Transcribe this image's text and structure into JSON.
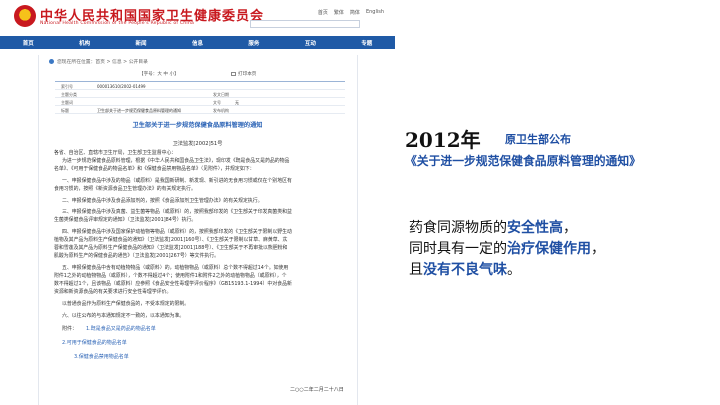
{
  "site": {
    "title": "中华人民共和国国家卫生健康委员会",
    "subtitle": "National Health Commission of the People's Republic of China",
    "top_links": [
      "首页",
      "繁体",
      "简体",
      "English"
    ]
  },
  "nav": [
    "首页",
    "机构",
    "新闻",
    "信息",
    "服务",
    "互动",
    "专题"
  ],
  "breadcrumb": "您现在所在位置：首页 > 信息 > 公开目录",
  "toolbar": {
    "font_size": "【字号：大 中 小】",
    "print": "打印本页"
  },
  "meta": {
    "rows": [
      {
        "k1": "索引号",
        "v1": "000013610/2002-01499",
        "k2": "",
        "v2": ""
      },
      {
        "k1": "主题分类",
        "v1": "",
        "k2": "发文日期",
        "v2": ""
      },
      {
        "k1": "主题词",
        "v1": "",
        "k2": "文号",
        "v2": "无"
      },
      {
        "k1": "标题",
        "v1": "卫生部关于进一步规范保健食品原料管理的通知",
        "k2": "发布机构",
        "v2": ""
      }
    ]
  },
  "document": {
    "title": "卫生部关于进一步规范保健食品原料管理的通知",
    "number": "卫法监发[2002]51号",
    "paragraphs": [
      "各省、自治区、直辖市卫生厅局，卫生部卫生监督中心：",
      "为进一步规范保健食品原料管理，根据《中华人民共和国食品卫生法》，现印发《既是食品又是药品的物品",
      "名单》、《可用于保健食品的物品名单》和《保健食品禁用物品名单》（见附件），并规定如下：",
      "一、申报保健食品中涉及的物品（或原料）是我国新研制、新发现、新引进的无食用习惯或仅在个别地区有",
      "食用习惯的，按照《新资源食品卫生管理办法》的有关规定执行。",
      "二、申报保健食品中涉及食品添加剂的，按照《食品添加剂卫生管理办法》的有关规定执行。",
      "三、申报保健食品中涉及真菌、益生菌等物品（或原料）的，按照我部印发的《卫生部关于印发真菌类和益",
      "生菌类保健食品评审规定的通知》（卫法监发[2001]84号）执行。",
      "四、申报保健食品中涉及国家保护动植物等物品（或原料）的，按照我部印发的《卫生部关于限制以野生动",
      "植物及其产品为原料生产保健食品的通知》（卫法监发[2001]160号）、《卫生部关于限制以甘草、麻黄草、苁",
      "蓉和雪莲及其产品为原料生产保健食品的通知》（卫法监发[2001]188号）、《卫生部关于不再审批以熊胆粉和",
      "肌酸为原料生产的保健食品的通告》（卫法监发[2001]267号）等文件执行。",
      "五、申报保健食品中含有动植物物品（或原料）的，动植物物品（或原料）总个数不得超过14个。如使用",
      "附件1之外的动植物物品（或原料），个数不得超过4个；使用附件1和附件2之外的动植物物品（或原料），个",
      "数不得超过1个，且该物品（或原料）应参照《食品安全性毒理学评价程序》（GB15193.1-1994）中对食品新",
      "资源和新资源食品的有关要求进行安全性毒理学评价。",
      "以普通食品作为原料生产保健食品的，不受本规定的限制。",
      "六、以往公布的与本通知规定不一致的，以本通知为准。"
    ],
    "attachments_label": "附件：",
    "attachments": [
      "1.既是食品又是药品的物品名单",
      "2.可用于保健食品的物品名单",
      "3.保健食品禁用物品名单"
    ],
    "date": "二○○二年二月二十八日"
  },
  "slide": {
    "year": "2012年",
    "source": "原卫生部公布",
    "doc_title": "《关于进一步规范保健食品原料管理的通知》",
    "lines": [
      [
        {
          "t": "药食同源物质的",
          "h": false
        },
        {
          "t": "安全性高",
          "h": true
        },
        {
          "t": "，",
          "h": false
        }
      ],
      [
        {
          "t": "同时具有一定的",
          "h": false
        },
        {
          "t": "治疗保健作用",
          "h": true
        },
        {
          "t": "，",
          "h": false
        }
      ],
      [
        {
          "t": "且",
          "h": false
        },
        {
          "t": "没有不良气味",
          "h": true
        },
        {
          "t": "。",
          "h": false
        }
      ]
    ]
  },
  "colors": {
    "nav_blue": "#1f5aa6",
    "brand_red": "#c8191f",
    "link_blue": "#2c64b6",
    "highlight_blue": "#1f4fa3"
  }
}
